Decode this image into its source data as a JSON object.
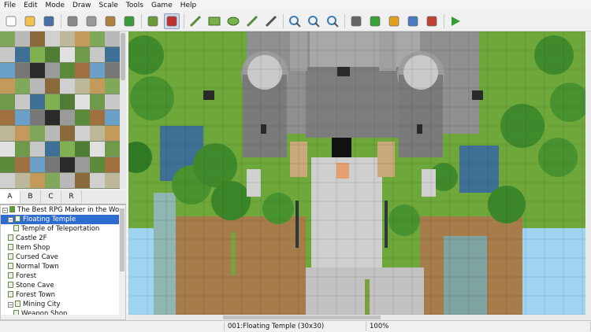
{
  "menu": [
    "File",
    "Edit",
    "Mode",
    "Draw",
    "Scale",
    "Tools",
    "Game",
    "Help"
  ],
  "toolbar": {
    "icons": [
      "new-project-icon",
      "open-project-icon",
      "save-project-icon",
      "cut-icon",
      "copy-icon",
      "paste-icon",
      "undo-icon",
      "map-mode-icon",
      "event-mode-icon",
      "pencil-icon",
      "rectangle-icon",
      "ellipse-icon",
      "fill-icon",
      "shadow-pen-icon",
      "zoom-in-icon",
      "zoom-out-icon",
      "actual-size-icon",
      "database-icon",
      "plugin-manager-icon",
      "sound-test-icon",
      "event-searcher-icon",
      "character-generator-icon",
      "playtest-icon"
    ]
  },
  "tileset_tabs": [
    "A",
    "B",
    "C",
    "R"
  ],
  "tileset_active_tab": "A",
  "map_tree": [
    {
      "label": "The Best RPG Maker in the World",
      "level": 0,
      "expander": "−",
      "root": true
    },
    {
      "label": "Floating Temple",
      "level": 1,
      "expander": "−",
      "selected": true
    },
    {
      "label": "Temple of Teleportation",
      "level": 2
    },
    {
      "label": "Castle 2F",
      "level": 1
    },
    {
      "label": "Item Shop",
      "level": 1
    },
    {
      "label": "Cursed Cave",
      "level": 1
    },
    {
      "label": "Normal Town",
      "level": 1
    },
    {
      "label": "Forest",
      "level": 1
    },
    {
      "label": "Stone Cave",
      "level": 1
    },
    {
      "label": "Forest Town",
      "level": 1
    },
    {
      "label": "Mining City",
      "level": 1,
      "expander": "−"
    },
    {
      "label": "Weapon Shop",
      "level": 2
    }
  ],
  "status": {
    "map": "001:Floating Temple (30x30)",
    "zoom": "100%"
  },
  "colors": {
    "selection": "#2f6cd0",
    "grass": "#6ea83a",
    "stone": "#8f8f8f",
    "water": "#5a98c8"
  }
}
